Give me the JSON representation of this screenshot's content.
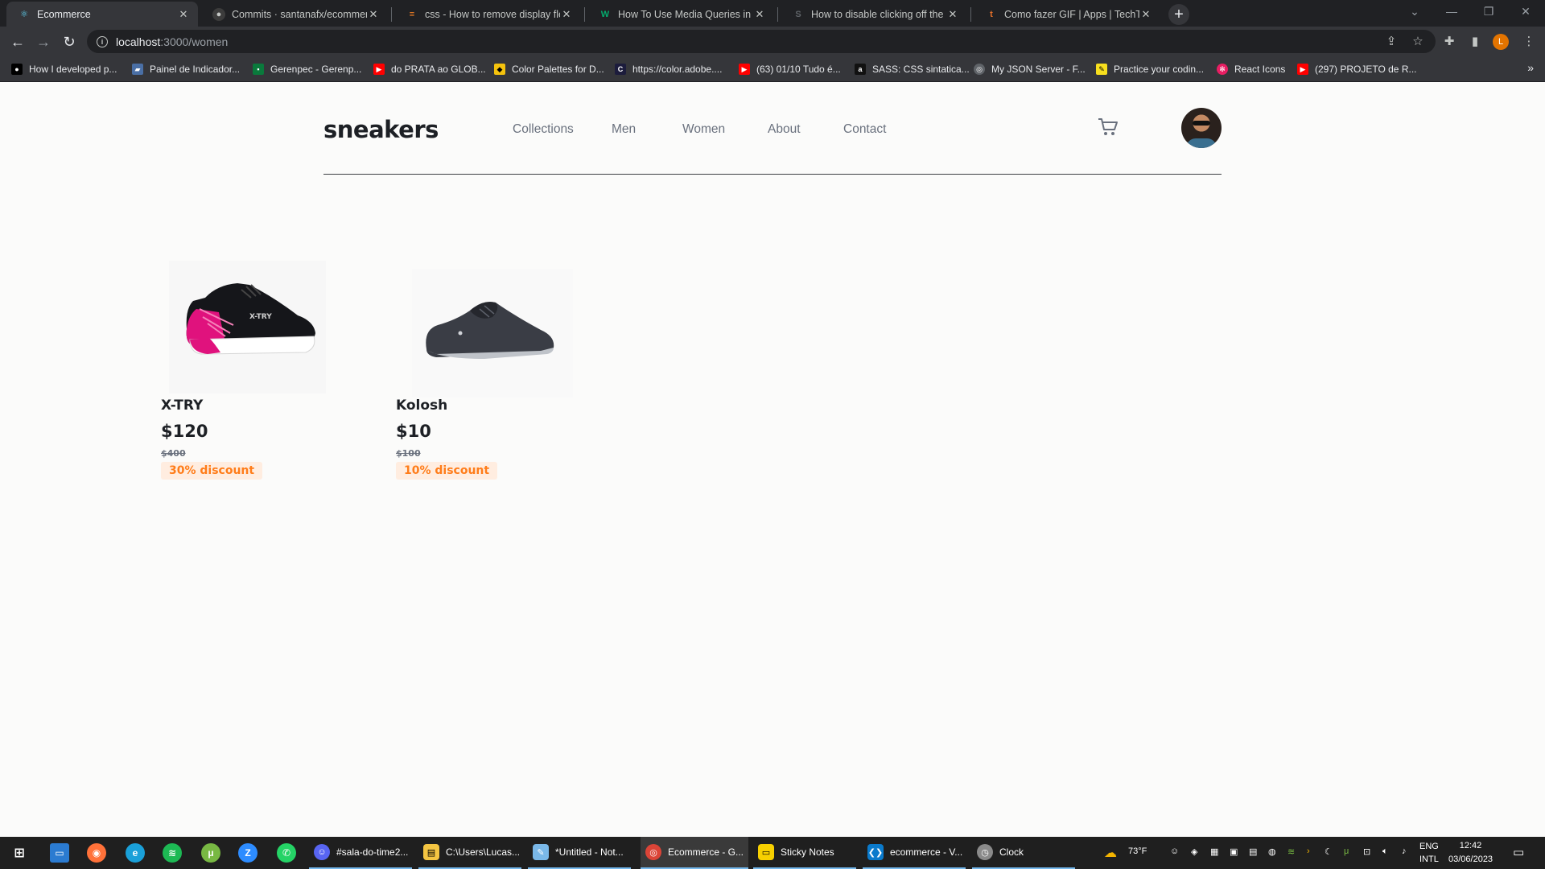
{
  "browser": {
    "tabs": [
      {
        "title": "Ecommerce",
        "active": true
      },
      {
        "title": "Commits · santanafx/ecommerce",
        "active": false
      },
      {
        "title": "css - How to remove display flex",
        "active": false
      },
      {
        "title": "How To Use Media Queries in Ja",
        "active": false
      },
      {
        "title": "How to disable clicking off the m",
        "active": false
      },
      {
        "title": "Como fazer GIF | Apps | TechTudo",
        "active": false
      }
    ],
    "url_host": "localhost",
    "url_path": ":3000/women",
    "profile_initial": "L",
    "bookmarks": [
      "How I developed p...",
      "Painel de Indicador...",
      "Gerenpec - Gerenp...",
      "do PRATA ao GLOB...",
      "Color Palettes for D...",
      "https://color.adobe....",
      "(63) 01/10 Tudo é...",
      "SASS: CSS sintatica...",
      "My JSON Server - F...",
      "Practice your codin...",
      "React Icons",
      "(297) PROJETO de R..."
    ]
  },
  "site": {
    "logo": "sneakers",
    "nav": [
      "Collections",
      "Men",
      "Women",
      "About",
      "Contact"
    ],
    "accent_color": "#ff7d1a",
    "products": [
      {
        "name": "X-TRY",
        "price": "$120",
        "old_price": "$400",
        "discount": "30% discount"
      },
      {
        "name": "Kolosh",
        "price": "$10",
        "old_price": "$100",
        "discount": "10% discount"
      }
    ]
  },
  "taskbar": {
    "apps": [
      "#sala-do-time2...",
      "C:\\Users\\Lucas...",
      "*Untitled - Not...",
      "Ecommerce - G...",
      "Sticky Notes",
      "ecommerce - V...",
      "Clock"
    ],
    "weather": "73°F",
    "lang_top": "ENG",
    "lang_bottom": "INTL",
    "time": "12:42",
    "date": "03/06/2023"
  }
}
